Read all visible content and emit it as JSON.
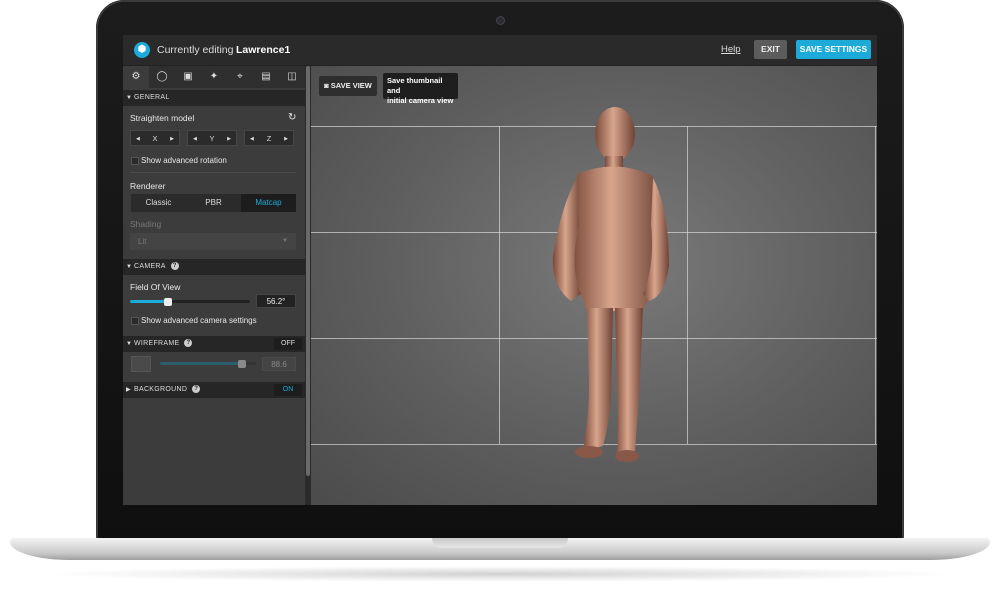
{
  "header": {
    "editing_label": "Currently editing",
    "model_name": "Lawrence1",
    "help": "Help",
    "exit": "EXIT",
    "save_settings": "SAVE SETTINGS"
  },
  "tabs": [
    {
      "icon": "gear-icon",
      "glyph": "⚙"
    },
    {
      "icon": "lightbulb-icon",
      "glyph": "💡"
    },
    {
      "icon": "image-icon",
      "glyph": "▣"
    },
    {
      "icon": "magic-wand-icon",
      "glyph": "✦"
    },
    {
      "icon": "map-pin-icon",
      "glyph": "⌖"
    },
    {
      "icon": "film-icon",
      "glyph": "▤"
    },
    {
      "icon": "vr-icon",
      "glyph": "◫"
    }
  ],
  "general": {
    "title": "GENERAL",
    "straighten_label": "Straighten model",
    "axes": [
      "X",
      "Y",
      "Z"
    ],
    "advanced_rotation": "Show advanced rotation",
    "renderer_label": "Renderer",
    "renderer_options": [
      "Classic",
      "PBR",
      "Matcap"
    ],
    "renderer_selected": "Matcap",
    "shading_label": "Shading",
    "shading_value": "Lit"
  },
  "camera": {
    "title": "CAMERA",
    "fov_label": "Field Of View",
    "fov_value": "56.2°",
    "fov_fraction": 0.32,
    "advanced_camera": "Show advanced camera settings"
  },
  "wireframe": {
    "title": "WIREFRAME",
    "toggle": "OFF",
    "value": "88.6",
    "fraction": 0.85
  },
  "background": {
    "title": "BACKGROUND",
    "toggle": "ON"
  },
  "viewport": {
    "save_view": "SAVE VIEW",
    "tooltip_line1": "Save thumbnail and",
    "tooltip_line2": "initial camera view"
  },
  "colors": {
    "accent": "#1caad9",
    "model": "#b07a63"
  }
}
